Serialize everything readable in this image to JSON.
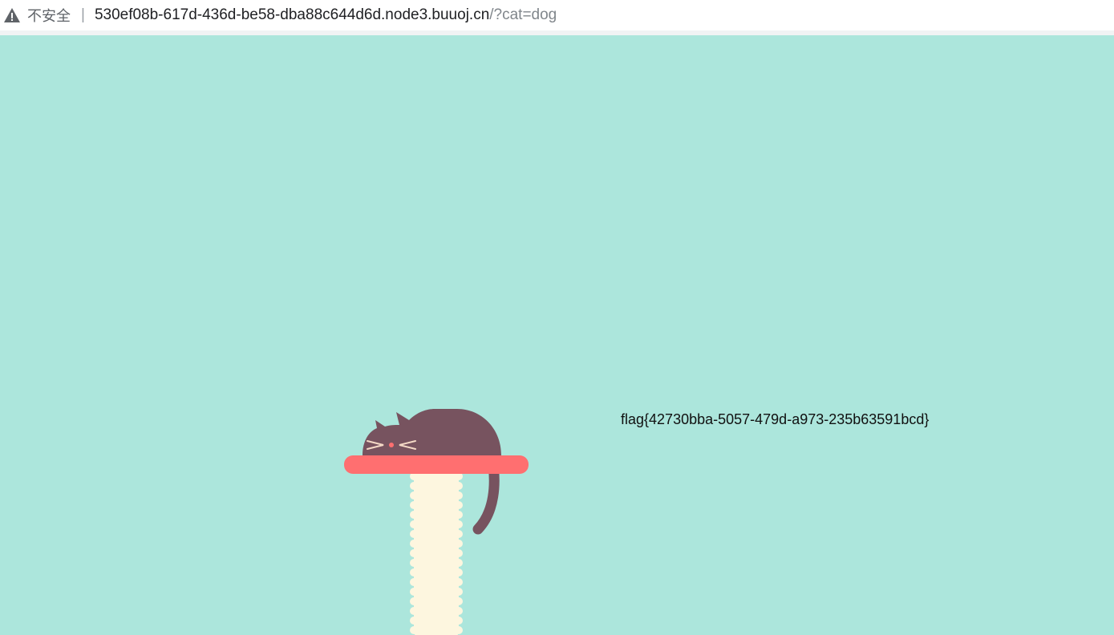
{
  "browser": {
    "security_label": "不安全",
    "separator": "|",
    "url_host": "530ef08b-617d-436d-be58-dba88c644d6d.node3.buuoj.cn",
    "url_path": "/?cat=dog"
  },
  "page": {
    "flag_text": "flag{42730bba-5057-479d-a973-235b63591bcd}",
    "background": "#ace6dc"
  },
  "colors": {
    "shelf": "#ff6f70",
    "post": "#fdf6df",
    "cat": "#77535f",
    "whisker": "#f4d9c6",
    "nose": "#ff6f70"
  },
  "icons": {
    "security": "warning-triangle-icon"
  }
}
